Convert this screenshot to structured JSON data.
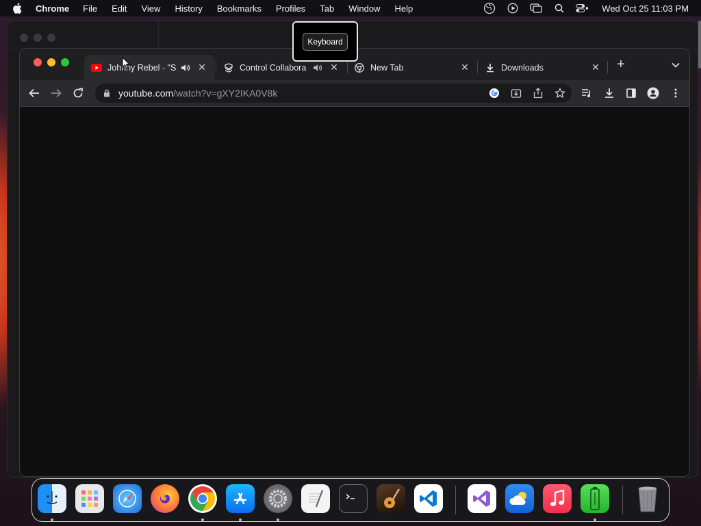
{
  "menubar": {
    "app_name": "Chrome",
    "items": [
      "File",
      "Edit",
      "View",
      "History",
      "Bookmarks",
      "Profiles",
      "Tab",
      "Window",
      "Help"
    ],
    "clock": "Wed Oct 25  11:03 PM"
  },
  "tooltip": {
    "label": "Keyboard"
  },
  "tabs": [
    {
      "title": "Johnny Rebel - \"S",
      "favicon": "youtube-icon",
      "audio": true,
      "active": true
    },
    {
      "title": "Control Collabora",
      "favicon": "puzzle-icon",
      "audio": true,
      "active": false
    },
    {
      "title": "New Tab",
      "favicon": "chrome-icon",
      "audio": false,
      "active": false
    },
    {
      "title": "Downloads",
      "favicon": "download-icon",
      "audio": false,
      "active": false
    }
  ],
  "omnibox": {
    "url_domain": "youtube.com",
    "url_path": "/watch?v=gXY2IKA0V8k"
  },
  "dock": {
    "apps": [
      "Finder",
      "Launchpad",
      "Safari",
      "Firefox",
      "Google Chrome",
      "App Store",
      "System Settings",
      "TextEdit",
      "Terminal",
      "GarageBand",
      "Visual Studio Code",
      "Visual Studio",
      "Weather",
      "Music",
      "Battery Monitor",
      "Trash"
    ]
  },
  "colors": {
    "accent_red": "#ff5f57",
    "accent_yellow": "#febc2e",
    "accent_green": "#28c840",
    "youtube_red": "#ff0000"
  }
}
